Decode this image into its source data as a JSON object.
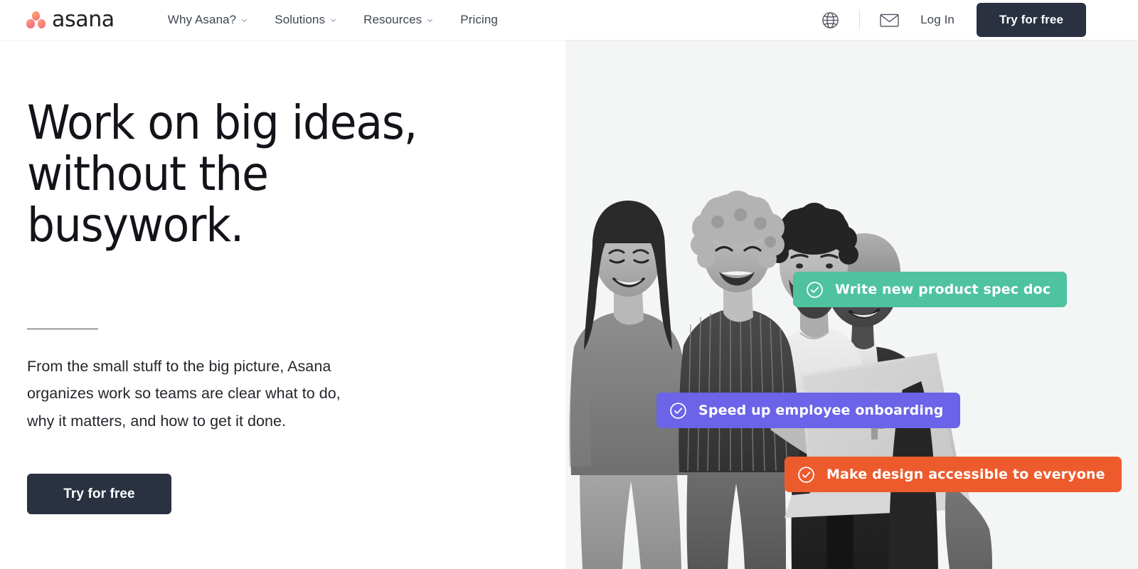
{
  "nav": {
    "logo": {
      "wordmark": "asana",
      "icon": "asana-logo-dots"
    },
    "links": [
      {
        "label": "Why Asana?",
        "has_dropdown": true
      },
      {
        "label": "Solutions",
        "has_dropdown": true
      },
      {
        "label": "Resources",
        "has_dropdown": true
      },
      {
        "label": "Pricing",
        "has_dropdown": false
      }
    ],
    "globe_icon": "globe-icon",
    "mail_icon": "envelope-icon",
    "login_label": "Log In",
    "cta_label": "Try for free"
  },
  "hero": {
    "headline_line1": "Work on big ideas,",
    "headline_line2": "without the busywork.",
    "subcopy": "From the small stuff to the big picture, Asana organizes work so teams are clear what to do, why it matters, and how to get it done.",
    "cta_label": "Try for free",
    "pills": [
      {
        "label": "Write new product spec doc",
        "color": "#4fc2a0",
        "icon": "check-circle-icon"
      },
      {
        "label": "Speed up employee onboarding",
        "color": "#6b63e8",
        "icon": "check-circle-icon"
      },
      {
        "label": "Make design accessible to everyone",
        "color": "#ed5b2d",
        "icon": "check-circle-icon"
      }
    ],
    "image_alt": "Four colleagues gathered around a laptop, smiling"
  },
  "colors": {
    "dark_button": "#2a3140",
    "text_primary": "#12141a",
    "text_secondary": "#3f4650",
    "panel_background": "#f4f5f5",
    "green": "#4fc2a0",
    "purple": "#6b63e8",
    "orange": "#ed5b2d"
  }
}
